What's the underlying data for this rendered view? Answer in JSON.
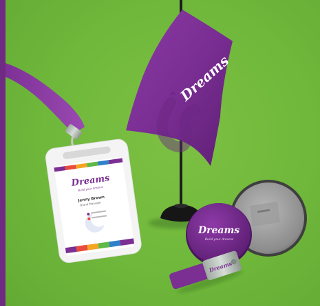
{
  "brand": {
    "name": "Dreams",
    "tagline": "Build your dreams",
    "primary_color": "#7b2f93",
    "background_color": "#6fb83b"
  },
  "id_card": {
    "person_name": "Jenny Brown",
    "person_role": "Brand Manager"
  }
}
